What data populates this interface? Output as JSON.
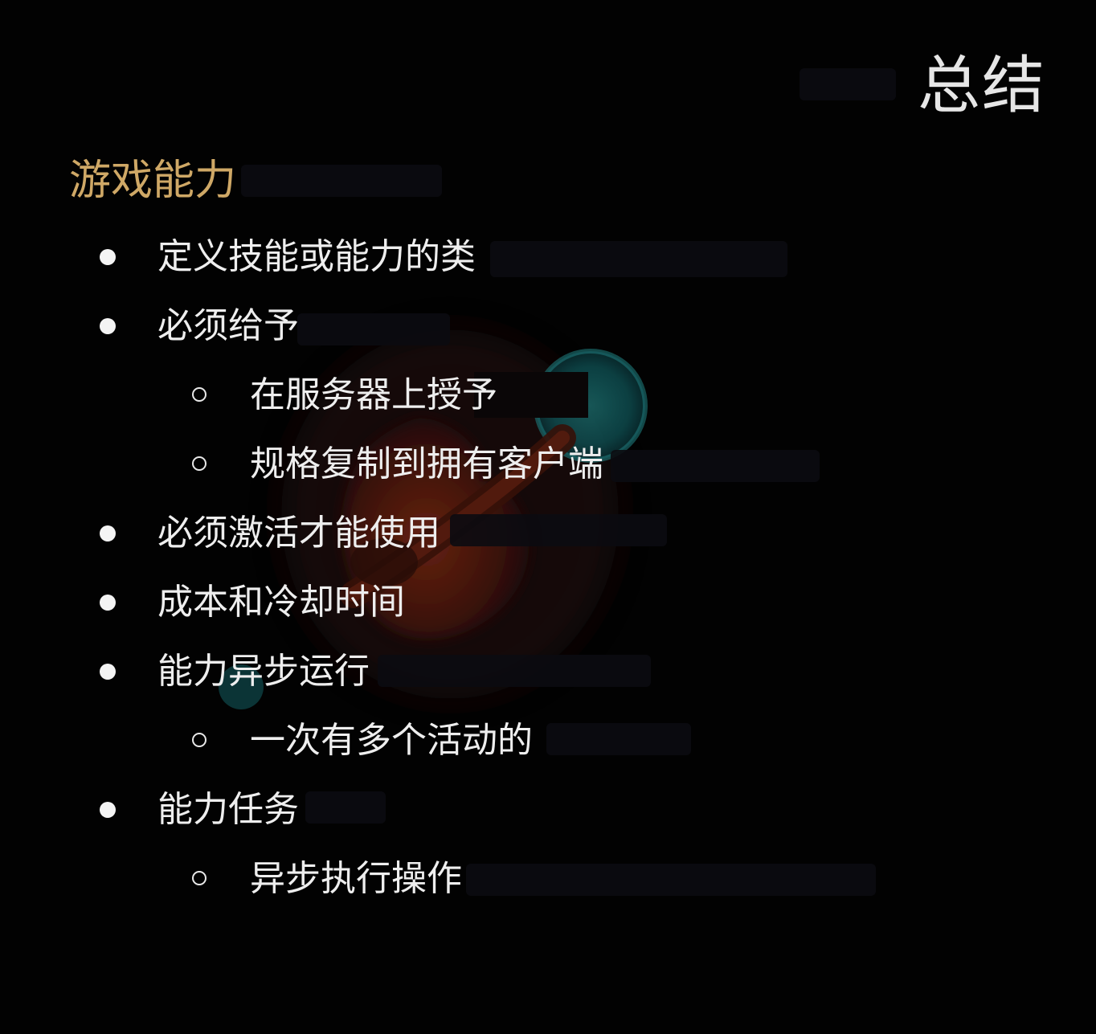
{
  "slide": {
    "title": "总结",
    "section": "游戏能力",
    "items": [
      {
        "level": 1,
        "text": "定义技能或能力的类"
      },
      {
        "level": 1,
        "text": "必须给予"
      },
      {
        "level": 2,
        "text": "在服务器上授予"
      },
      {
        "level": 2,
        "text": "规格复制到拥有客户端"
      },
      {
        "level": 1,
        "text": "必须激活才能使用"
      },
      {
        "level": 1,
        "text": "成本和冷却时间"
      },
      {
        "level": 1,
        "text": "能力异步运行"
      },
      {
        "level": 2,
        "text": "一次有多个活动的"
      },
      {
        "level": 1,
        "text": "能力任务"
      },
      {
        "level": 2,
        "text": "异步执行操作"
      }
    ]
  },
  "colors": {
    "background": "#020202",
    "title": "#e6e6e6",
    "section": "#cfa866",
    "text": "#eeeeee"
  }
}
